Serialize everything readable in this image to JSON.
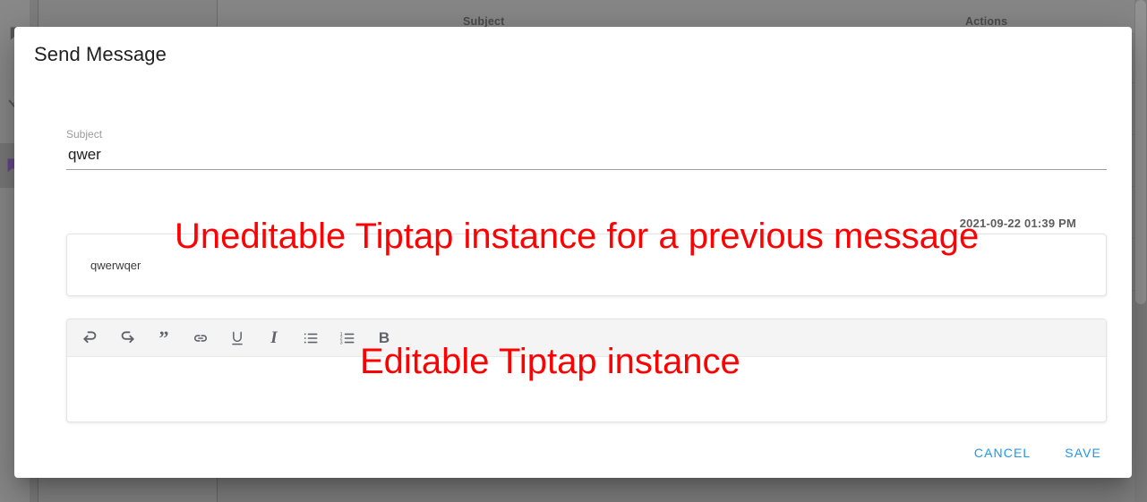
{
  "background": {
    "table": {
      "columns": [
        "Subject",
        "Actions"
      ]
    },
    "sidebar_icons": [
      "bookmark-icon",
      "wrench-icon",
      "message-icon"
    ]
  },
  "dialog": {
    "title": "Send Message",
    "subject_field": {
      "label": "Subject",
      "value": "qwer",
      "placeholder": "Subject"
    },
    "previous_message": {
      "timestamp": "2021-09-22 01:39 PM",
      "content": "qwerwqer"
    },
    "editor": {
      "content": "",
      "placeholder": "",
      "toolbar": [
        {
          "name": "undo-icon",
          "label": "Undo"
        },
        {
          "name": "redo-icon",
          "label": "Redo"
        },
        {
          "name": "blockquote-icon",
          "label": "Blockquote"
        },
        {
          "name": "link-icon",
          "label": "Link"
        },
        {
          "name": "underline-icon",
          "label": "Underline"
        },
        {
          "name": "italic-icon",
          "label": "Italic"
        },
        {
          "name": "bullet-list-icon",
          "label": "Bullet List"
        },
        {
          "name": "ordered-list-icon",
          "label": "Ordered List"
        },
        {
          "name": "bold-icon",
          "label": "Bold"
        }
      ]
    },
    "actions": {
      "cancel_label": "CANCEL",
      "save_label": "SAVE"
    }
  },
  "annotations": {
    "uneditable": "Uneditable Tiptap instance for a previous message",
    "editable": "Editable Tiptap instance"
  },
  "colors": {
    "accent": "#2196f3",
    "annotation": "#ff0000",
    "dialog_bg": "#ffffff",
    "toolbar_bg": "#f4f4f4"
  }
}
